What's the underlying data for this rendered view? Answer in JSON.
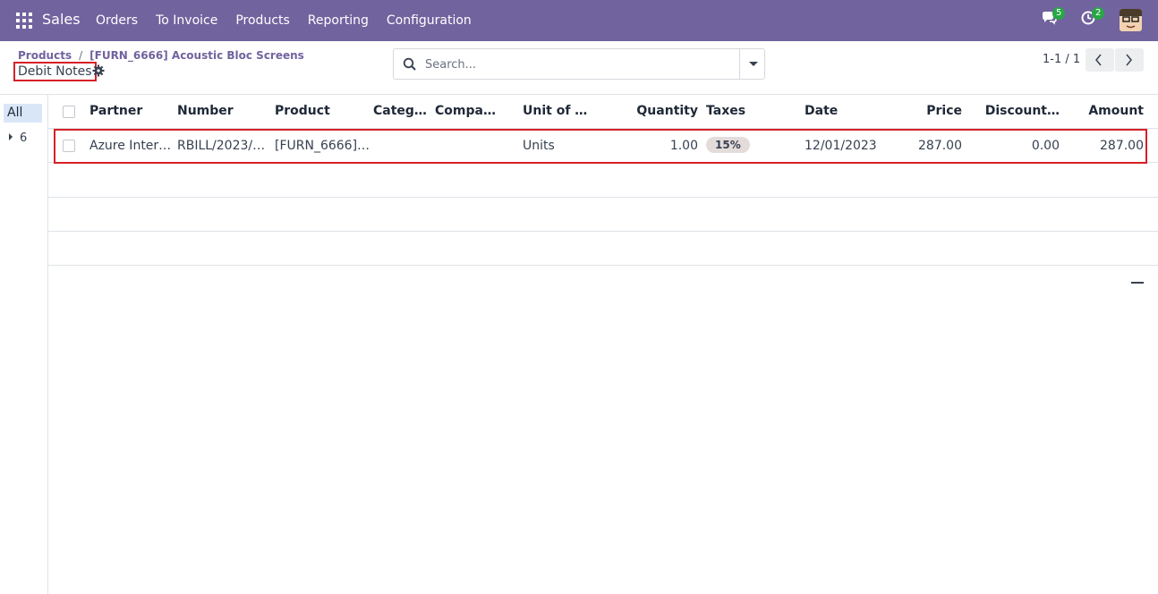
{
  "navbar": {
    "app_name": "Sales",
    "menu": [
      "Orders",
      "To Invoice",
      "Products",
      "Reporting",
      "Configuration"
    ],
    "messages_count": "5",
    "activities_count": "2",
    "bg_color": "#71639e"
  },
  "breadcrumb": {
    "items": [
      "Products",
      "[FURN_6666] Acoustic Bloc Screens"
    ],
    "separator": "/"
  },
  "page_title": "Debit Notes",
  "search": {
    "placeholder": "Search..."
  },
  "pager": {
    "value": "1-1 / 1"
  },
  "side_panel": {
    "all_label": "All",
    "group_label": "6"
  },
  "table": {
    "columns": [
      "Partner",
      "Number",
      "Product",
      "Categ…",
      "Compa…",
      "Unit of …",
      "Quantity",
      "Taxes",
      "Date",
      "Price",
      "Discount…",
      "Amount"
    ],
    "rows": [
      {
        "partner": "Azure Inter…",
        "number": "RBILL/2023/…",
        "product": "[FURN_6666]…",
        "category": "",
        "company": "",
        "uom": "Units",
        "quantity": "1.00",
        "taxes": "15%",
        "date": "12/01/2023",
        "price": "287.00",
        "discount": "0.00",
        "amount": "287.00"
      }
    ]
  },
  "colors": {
    "highlight": "#d72027",
    "accent": "#71639e"
  }
}
